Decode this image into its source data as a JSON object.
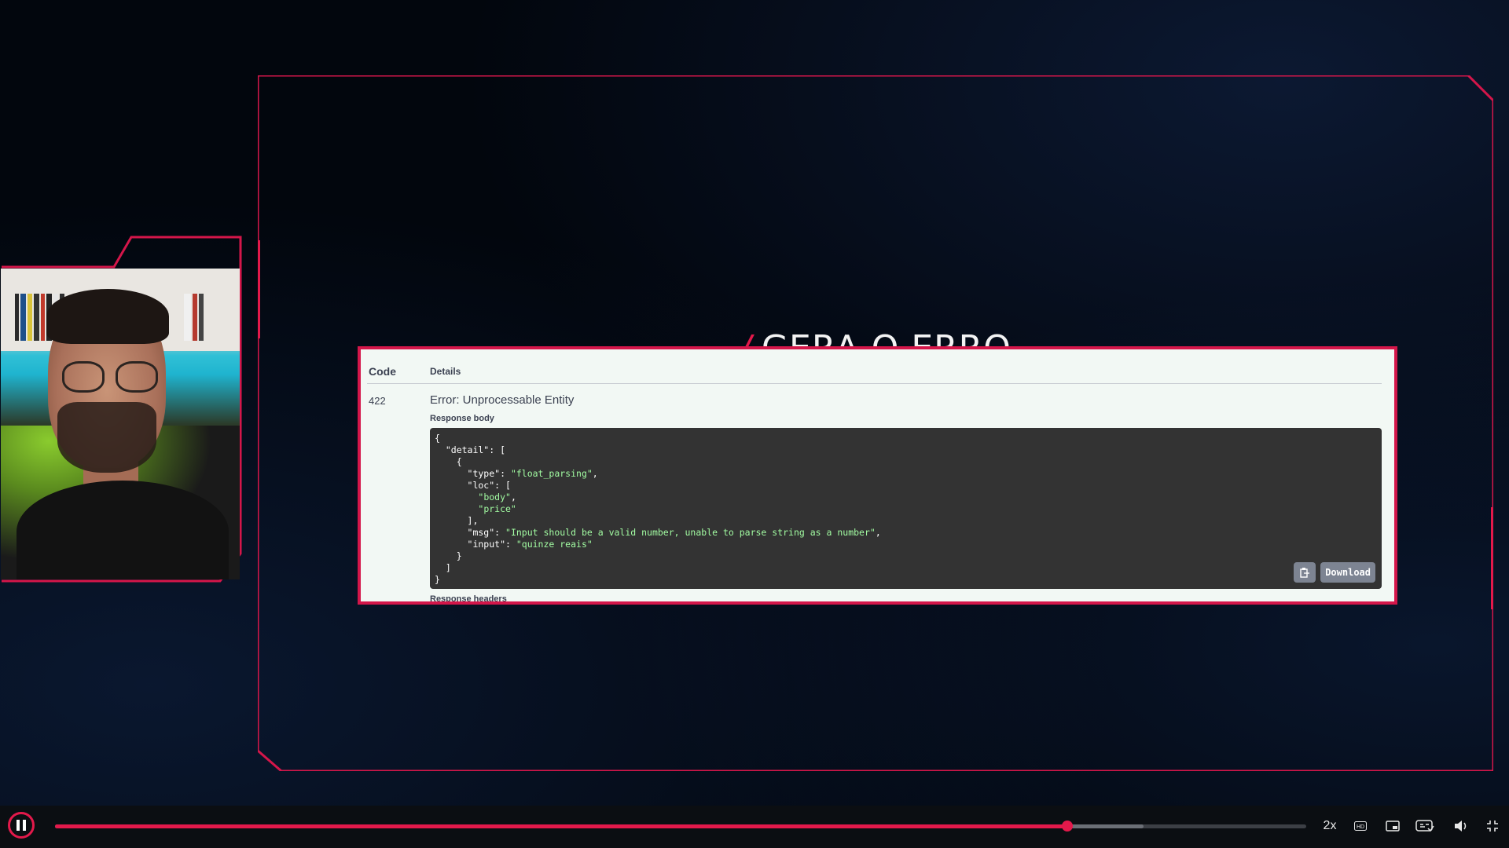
{
  "slide": {
    "title": "GERA O ERRO",
    "slash": "/"
  },
  "response_panel": {
    "col_code": "Code",
    "col_details": "Details",
    "code": "422",
    "error_title": "Error: Unprocessable Entity",
    "response_body_label": "Response body",
    "body_lines": [
      {
        "indent": "",
        "key": "",
        "sep": "",
        "str": "",
        "tail": "{"
      },
      {
        "indent": "  ",
        "key": "\"detail\"",
        "sep": ": ",
        "str": "",
        "tail": "["
      },
      {
        "indent": "    ",
        "key": "",
        "sep": "",
        "str": "",
        "tail": "{"
      },
      {
        "indent": "      ",
        "key": "\"type\"",
        "sep": ": ",
        "str": "\"float_parsing\"",
        "tail": ","
      },
      {
        "indent": "      ",
        "key": "\"loc\"",
        "sep": ": ",
        "str": "",
        "tail": "["
      },
      {
        "indent": "        ",
        "key": "",
        "sep": "",
        "str": "\"body\"",
        "tail": ","
      },
      {
        "indent": "        ",
        "key": "",
        "sep": "",
        "str": "\"price\"",
        "tail": ""
      },
      {
        "indent": "      ",
        "key": "",
        "sep": "",
        "str": "",
        "tail": "],"
      },
      {
        "indent": "      ",
        "key": "\"msg\"",
        "sep": ": ",
        "str": "\"Input should be a valid number, unable to parse string as a number\"",
        "tail": ","
      },
      {
        "indent": "      ",
        "key": "\"input\"",
        "sep": ": ",
        "str": "\"quinze reais\"",
        "tail": ""
      },
      {
        "indent": "    ",
        "key": "",
        "sep": "",
        "str": "",
        "tail": "}"
      },
      {
        "indent": "  ",
        "key": "",
        "sep": "",
        "str": "",
        "tail": "]"
      },
      {
        "indent": "",
        "key": "",
        "sep": "",
        "str": "",
        "tail": "}"
      }
    ],
    "download_label": "Download",
    "response_headers_label": "Response headers"
  },
  "player": {
    "progress_fraction": 0.809,
    "buffered_fraction": 0.87,
    "speed_label": "2x",
    "icons": [
      "pause-icon",
      "hd-icon",
      "picture-in-picture-icon",
      "captions-icon",
      "volume-icon",
      "fullscreen-exit-icon"
    ]
  },
  "colors": {
    "accent": "#e3194b",
    "panel_bg": "#f2f8f4",
    "code_bg": "#333333",
    "code_string": "#a2fca2"
  }
}
